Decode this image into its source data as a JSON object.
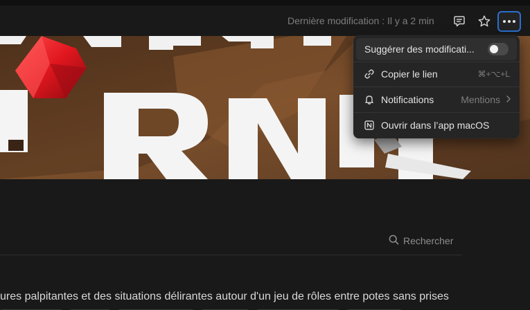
{
  "header": {
    "last_modified": "Dernière modification : Il y a 2 min",
    "comments_icon": "comment-icon",
    "favorite_icon": "star-icon",
    "more_icon": "more-horizontal-icon"
  },
  "cover": {
    "description_icon": "cover-image"
  },
  "search": {
    "label": "Rechercher",
    "icon": "search-icon"
  },
  "content": {
    "paragraph_line_1": "ures palpitantes et des situations délirantes autour d'un jeu de rôles entre potes sans prises"
  },
  "menu": {
    "items": [
      {
        "label": "Suggérer des modificati...",
        "control": "toggle",
        "toggle_on": false
      },
      {
        "label": "Copier le lien",
        "icon": "link-icon",
        "shortcut": "⌘+⌥+L"
      },
      {
        "label": "Notifications",
        "icon": "bell-icon",
        "value": "Mentions"
      },
      {
        "label": "Ouvrir dans l’app macOS",
        "icon": "notion-icon"
      }
    ]
  },
  "colors": {
    "background": "#191919",
    "menu_bg": "#252525",
    "focus_ring": "#2a6fd0",
    "cover_brown": "#6e4727",
    "gem_red": "#e0161e"
  }
}
